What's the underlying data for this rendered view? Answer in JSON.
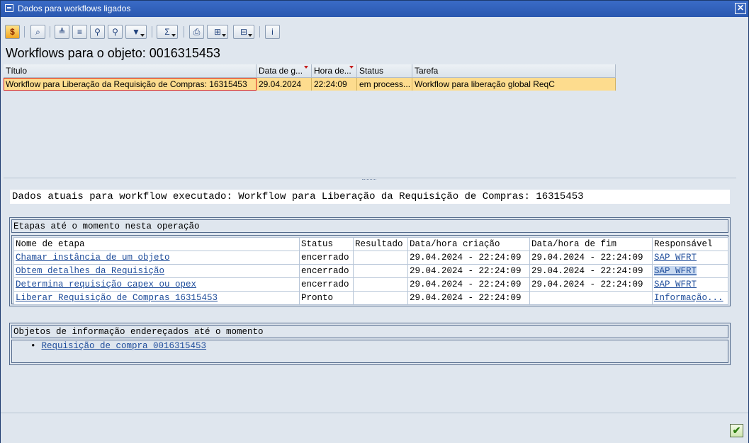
{
  "window": {
    "title": "Dados para workflows ligados",
    "close_glyph": "✕"
  },
  "toolbar": {
    "icons": [
      "workflow-log-icon",
      "details-icon",
      "sort-ascending-icon",
      "sort-descending-icon",
      "find-icon",
      "find-next-icon",
      "filter-icon",
      "sum-icon",
      "print-icon",
      "export-icon",
      "layout-icon",
      "info-icon"
    ]
  },
  "page_title": "Workflows para o objeto: 0016315453",
  "alv": {
    "columns": [
      "Título",
      "Data de g...",
      "Hora de...",
      "Status",
      "Tarefa"
    ],
    "rows": [
      [
        "Workflow para Liberação da Requisição de Compras: 16315453",
        "29.04.2024",
        "22:24:09",
        "em process...",
        "Workflow para liberação global ReqC"
      ]
    ]
  },
  "detail": {
    "heading": "Dados atuais para workflow executado: Workflow para Liberação da Requisição de Compras: 16315453",
    "steps_caption": "Etapas até o momento nesta operação",
    "steps_columns": [
      "Nome de etapa",
      "Status",
      "Resultado",
      "Data/hora criação",
      "Data/hora de fim",
      "Responsável"
    ],
    "steps": [
      {
        "name": "Chamar instância de um objeto",
        "status": "encerrado",
        "result": "",
        "created": "29.04.2024 - 22:24:09",
        "ended": "29.04.2024 - 22:24:09",
        "responsible": "SAP WFRT"
      },
      {
        "name": "Obtem detalhes da Requisição",
        "status": "encerrado",
        "result": "",
        "created": "29.04.2024 - 22:24:09",
        "ended": "29.04.2024 - 22:24:09",
        "responsible": "SAP WFRT"
      },
      {
        "name": "Determina requisição capex ou opex",
        "status": "encerrado",
        "result": "",
        "created": "29.04.2024 - 22:24:09",
        "ended": "29.04.2024 - 22:24:09",
        "responsible": "SAP WFRT"
      },
      {
        "name": "Liberar Requisição de Compras 16315453",
        "status": "Pronto",
        "result": "",
        "created": "29.04.2024 - 22:24:09",
        "ended": "",
        "responsible": "Informação..."
      }
    ],
    "objects_caption": "Objetos de informação endereçados até o momento",
    "objects": [
      "Requisição de compra 0016315453"
    ]
  },
  "footer": {
    "ok_glyph": "✔"
  }
}
